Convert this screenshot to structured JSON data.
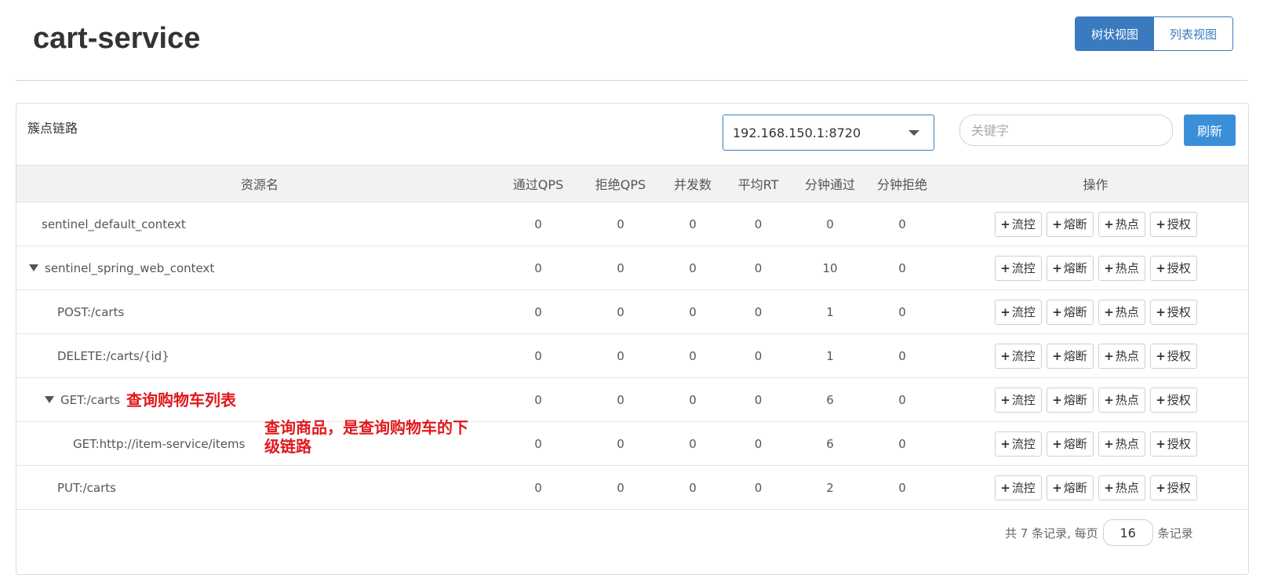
{
  "app": {
    "title": "cart-service"
  },
  "view_toggle": {
    "tree_label": "树状视图",
    "list_label": "列表视图",
    "active": "tree"
  },
  "panel": {
    "title": "簇点链路",
    "machine_select": {
      "value": "192.168.150.1:8720"
    },
    "keyword_search": {
      "placeholder": "关键字",
      "value": ""
    },
    "refresh_label": "刷新"
  },
  "table": {
    "columns": [
      "资源名",
      "通过QPS",
      "拒绝QPS",
      "并发数",
      "平均RT",
      "分钟通过",
      "分钟拒绝",
      "操作"
    ],
    "action_labels": [
      "流控",
      "熔断",
      "热点",
      "授权"
    ],
    "action_prefix": "+",
    "rows": [
      {
        "name": "sentinel_default_context",
        "pass_qps": "0",
        "block_qps": "0",
        "concurrency": "0",
        "avg_rt": "0",
        "minute_pass": "0",
        "minute_block": "0"
      },
      {
        "name": "sentinel_spring_web_context",
        "pass_qps": "0",
        "block_qps": "0",
        "concurrency": "0",
        "avg_rt": "0",
        "minute_pass": "10",
        "minute_block": "0"
      },
      {
        "name": "POST:/carts",
        "pass_qps": "0",
        "block_qps": "0",
        "concurrency": "0",
        "avg_rt": "0",
        "minute_pass": "1",
        "minute_block": "0"
      },
      {
        "name": "DELETE:/carts/{id}",
        "pass_qps": "0",
        "block_qps": "0",
        "concurrency": "0",
        "avg_rt": "0",
        "minute_pass": "1",
        "minute_block": "0"
      },
      {
        "name": "GET:/carts",
        "pass_qps": "0",
        "block_qps": "0",
        "concurrency": "0",
        "avg_rt": "0",
        "minute_pass": "6",
        "minute_block": "0"
      },
      {
        "name": "GET:http://item-service/items",
        "pass_qps": "0",
        "block_qps": "0",
        "concurrency": "0",
        "avg_rt": "0",
        "minute_pass": "6",
        "minute_block": "0"
      },
      {
        "name": "PUT:/carts",
        "pass_qps": "0",
        "block_qps": "0",
        "concurrency": "0",
        "avg_rt": "0",
        "minute_pass": "2",
        "minute_block": "0"
      }
    ]
  },
  "annotations": {
    "get_carts": "查询购物车列表",
    "item_service": "查询商品，是查询购物车的下级链路"
  },
  "pagination": {
    "prefix": "共 7 条记录, 每页",
    "page_size": "16",
    "suffix": "条记录"
  }
}
